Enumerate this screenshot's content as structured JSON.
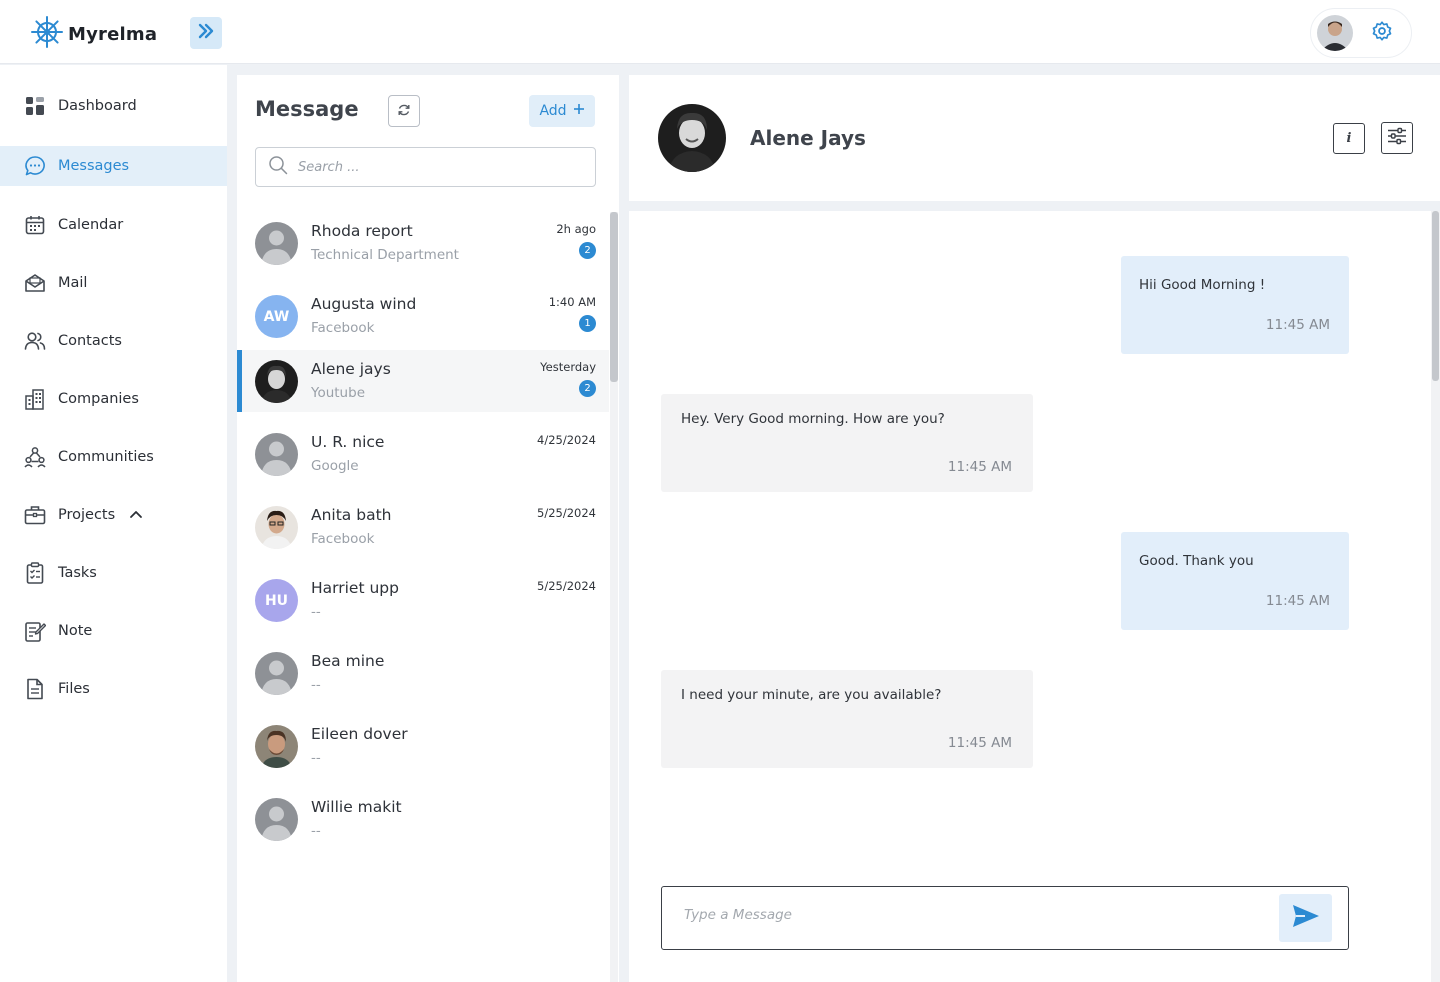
{
  "app": {
    "name": "Myrelma",
    "accent": "#2c8ad2"
  },
  "sidebar": {
    "items": [
      {
        "label": "Dashboard",
        "icon": "dashboard-icon"
      },
      {
        "label": "Messages",
        "icon": "chat-bubble-icon",
        "active": true
      },
      {
        "label": "Calendar",
        "icon": "calendar-icon"
      },
      {
        "label": "Mail",
        "icon": "mail-icon"
      },
      {
        "label": "Contacts",
        "icon": "contacts-icon"
      },
      {
        "label": "Companies",
        "icon": "buildings-icon"
      },
      {
        "label": "Communities",
        "icon": "communities-icon"
      },
      {
        "label": "Projects",
        "icon": "briefcase-icon",
        "expanded": true
      },
      {
        "label": "Tasks",
        "icon": "clipboard-check-icon"
      },
      {
        "label": "Note",
        "icon": "note-icon"
      },
      {
        "label": "Files",
        "icon": "file-icon"
      }
    ]
  },
  "list": {
    "title": "Message",
    "add_label": "Add",
    "search_placeholder": "Search ...",
    "conversations": [
      {
        "name": "Rhoda report",
        "sub": "Technical Department",
        "time": "2h ago",
        "badge": "2",
        "avatar": "placeholder"
      },
      {
        "name": "Augusta wind",
        "sub": "Facebook",
        "time": "1:40 AM",
        "badge": "1",
        "avatar": "initials",
        "initials": "AW",
        "color": "#86b4f0"
      },
      {
        "name": "Alene jays",
        "sub": "Youtube",
        "time": "Yesterday",
        "badge": "2",
        "avatar": "photo",
        "active": true
      },
      {
        "name": "U. R. nice",
        "sub": "Google",
        "time": "4/25/2024",
        "avatar": "placeholder"
      },
      {
        "name": "Anita bath",
        "sub": "Facebook",
        "time": "5/25/2024",
        "avatar": "photo"
      },
      {
        "name": "Harriet upp",
        "sub": "--",
        "time": "5/25/2024",
        "avatar": "initials",
        "initials": "HU",
        "color": "#a8a6ec"
      },
      {
        "name": "Bea mine",
        "sub": "--",
        "time": "",
        "avatar": "placeholder"
      },
      {
        "name": "Eileen dover",
        "sub": "--",
        "time": "",
        "avatar": "photo"
      },
      {
        "name": "Willie makit",
        "sub": "--",
        "time": "",
        "avatar": "placeholder"
      }
    ]
  },
  "chat": {
    "contact_name": "Alene Jays",
    "info_label": "i",
    "messages": [
      {
        "direction": "sent",
        "text": "Hii Good Morning !",
        "time": "11:45 AM"
      },
      {
        "direction": "received",
        "text": "Hey. Very Good morning. How are you?",
        "time": "11:45 AM"
      },
      {
        "direction": "sent",
        "text": "Good. Thank you",
        "time": "11:45 AM"
      },
      {
        "direction": "received",
        "text": "I need your minute, are you available?",
        "time": "11:45 AM"
      }
    ],
    "composer_placeholder": "Type a Message"
  }
}
